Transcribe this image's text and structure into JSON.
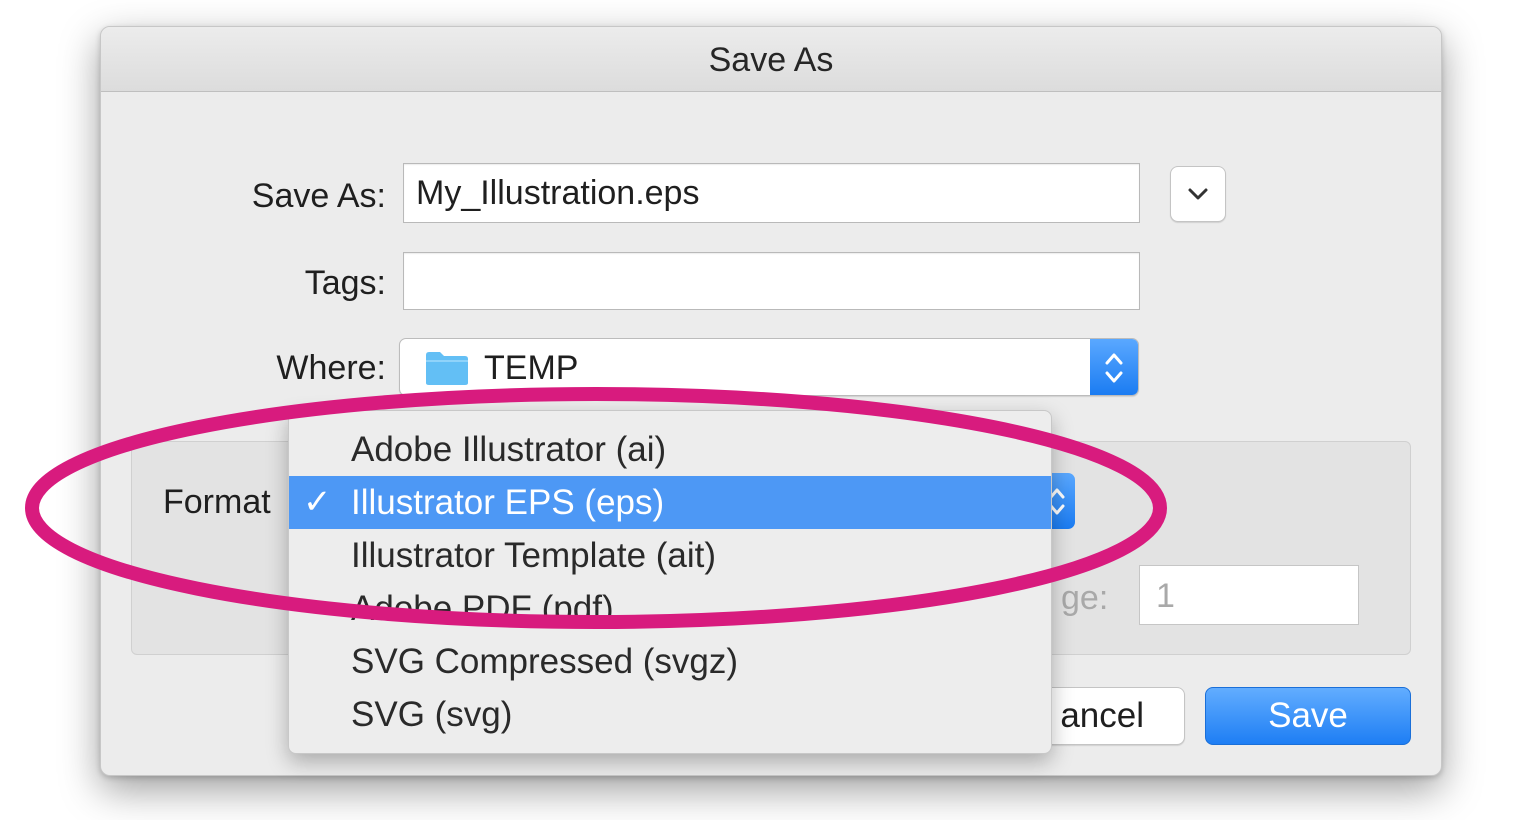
{
  "dialog": {
    "title": "Save As",
    "save_as_label": "Save As:",
    "filename_value": "My_Illustration.eps",
    "tags_label": "Tags:",
    "tags_value": "",
    "where_label": "Where:",
    "where_value": "TEMP",
    "format_label": "Format",
    "range_label_partial": "ge:",
    "page_value": "1",
    "cancel_label_partial": "ancel",
    "save_label": "Save"
  },
  "format_menu": {
    "items": [
      {
        "label": "Adobe Illustrator (ai)",
        "selected": false
      },
      {
        "label": "Illustrator EPS (eps)",
        "selected": true,
        "check": "✓"
      },
      {
        "label": "Illustrator Template (ait)",
        "selected": false
      },
      {
        "label": "Adobe PDF (pdf)",
        "selected": false
      },
      {
        "label": "SVG Compressed (svgz)",
        "selected": false
      },
      {
        "label": "SVG (svg)",
        "selected": false
      }
    ]
  },
  "icons": {
    "expand": "chevron-down-icon",
    "folder": "folder-icon",
    "stepper": "up-down-chevron-icon"
  },
  "colors": {
    "accent": "#1e7ef4",
    "selection": "#4d98f5",
    "annotation": "#d81b7e",
    "folder": "#63bff5"
  }
}
